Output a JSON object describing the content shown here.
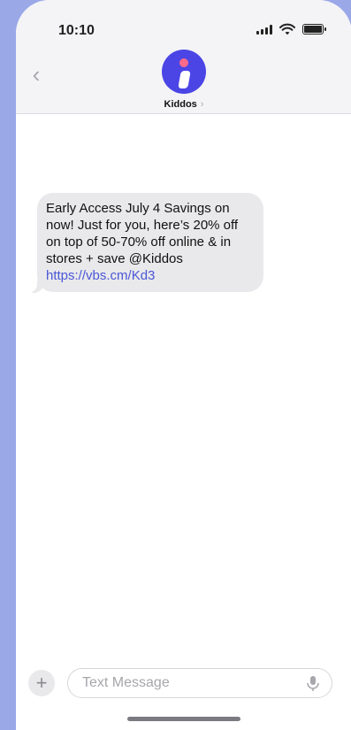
{
  "status_bar": {
    "time": "10:10"
  },
  "header": {
    "back_label": "‹",
    "contact_name": "Kiddos",
    "contact_chevron": "›"
  },
  "conversation": {
    "messages": [
      {
        "text": "Early Access July 4 Savings on now! Just for you, here’s 20% off on top of 50-70% off online & in stores + save @Kiddos",
        "link": "https://vbs.cm/Kd3"
      }
    ]
  },
  "composer": {
    "add_label": "+",
    "placeholder": "Text Message"
  },
  "icons": {
    "back": "chevron-left-icon",
    "contact": "info-avatar-icon",
    "signal": "cellular-signal-icon",
    "wifi": "wifi-icon",
    "battery": "battery-icon",
    "add": "plus-icon",
    "mic": "microphone-icon"
  },
  "colors": {
    "background": "#9aa8e8",
    "avatar": "#4b45e6",
    "avatar_dot": "#ff6a8a",
    "bubble": "#e9e9eb",
    "link": "#4a56d6"
  }
}
